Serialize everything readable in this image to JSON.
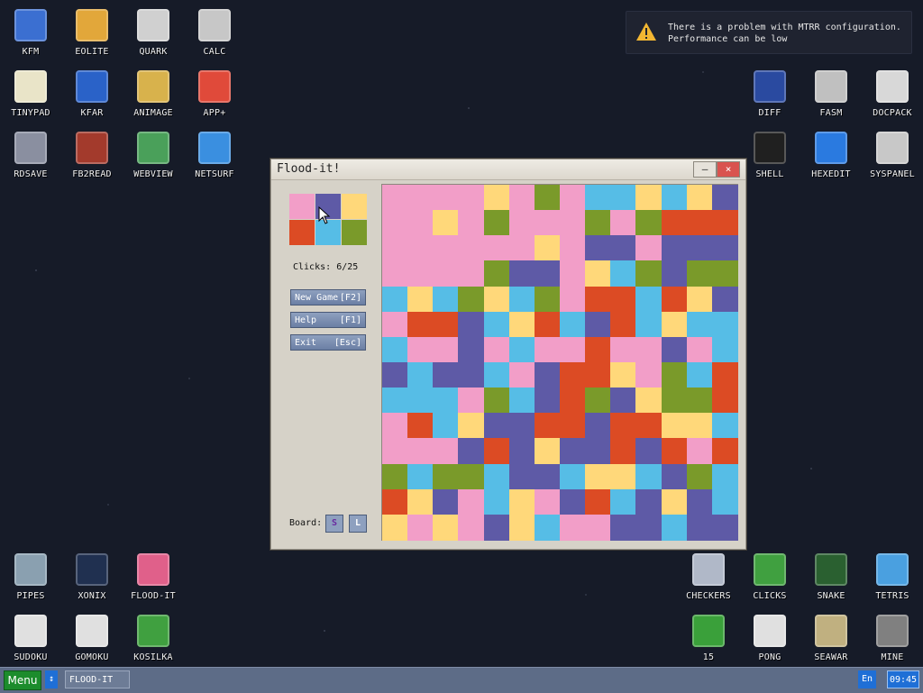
{
  "desktop": {
    "icons": [
      {
        "label": "KFM",
        "icon": "floppy-icon"
      },
      {
        "label": "EOLITE",
        "icon": "folder-icon"
      },
      {
        "label": "QUARK",
        "icon": "notebook-icon"
      },
      {
        "label": "CALC",
        "icon": "calculator-icon"
      },
      {
        "label": "TINYPAD",
        "icon": "notepad-icon"
      },
      {
        "label": "KFAR",
        "icon": "filemanager-icon"
      },
      {
        "label": "ANIMAGE",
        "icon": "paint-tools-icon"
      },
      {
        "label": "APP+",
        "icon": "cube-icon"
      },
      {
        "label": "RDSAVE",
        "icon": "disk-save-icon"
      },
      {
        "label": "FB2READ",
        "icon": "book-icon"
      },
      {
        "label": "WEBVIEW",
        "icon": "web-image-icon"
      },
      {
        "label": "NETSURF",
        "icon": "globe-icon"
      },
      {
        "label": "DIFF",
        "icon": "diff-icon"
      },
      {
        "label": "FASM",
        "icon": "assembler-icon"
      },
      {
        "label": "DOCPACK",
        "icon": "cabinet-icon"
      },
      {
        "label": "SHELL",
        "icon": "terminal-icon"
      },
      {
        "label": "HEXEDIT",
        "icon": "hex-icon"
      },
      {
        "label": "SYSPANEL",
        "icon": "sliders-icon"
      },
      {
        "label": "PIPES",
        "icon": "pipes-icon"
      },
      {
        "label": "XONIX",
        "icon": "xonix-icon"
      },
      {
        "label": "FLOOD-IT",
        "icon": "flood-icon"
      },
      {
        "label": "SUDOKU",
        "icon": "sudoku-icon"
      },
      {
        "label": "GOMOKU",
        "icon": "gomoku-icon"
      },
      {
        "label": "KOSILKA",
        "icon": "lawnmower-icon"
      },
      {
        "label": "CHECKERS",
        "icon": "checkers-icon"
      },
      {
        "label": "CLICKS",
        "icon": "clicks-icon"
      },
      {
        "label": "SNAKE",
        "icon": "snake-icon"
      },
      {
        "label": "TETRIS",
        "icon": "tetris-icon"
      },
      {
        "label": "15",
        "icon": "fifteen-icon"
      },
      {
        "label": "PONG",
        "icon": "pong-icon"
      },
      {
        "label": "SEAWAR",
        "icon": "seawar-icon"
      },
      {
        "label": "MINE",
        "icon": "mine-icon"
      }
    ]
  },
  "notification": {
    "line1": "There is a problem with MTRR configuration.",
    "line2": "Performance can be low"
  },
  "window": {
    "title": "Flood-it!",
    "minimize": "–",
    "close": "×",
    "clicks_label": "Clicks:",
    "clicks_value": "6/25",
    "buttons": [
      {
        "label": "New Game",
        "key": "[F2]"
      },
      {
        "label": "Help",
        "key": "[F1]"
      },
      {
        "label": "Exit",
        "key": "[Esc]"
      }
    ],
    "board_label": "Board:",
    "size_s": "S",
    "size_l": "L"
  },
  "colors": {
    "P": "#f29ec8",
    "V": "#5e5aa6",
    "Y": "#ffd87a",
    "R": "#dc4b24",
    "B": "#56bde6",
    "G": "#7a9a2a"
  },
  "palette": [
    "P",
    "V",
    "Y",
    "R",
    "B",
    "G"
  ],
  "board": [
    "PPPPYPGPBBYBYV",
    "PPYPGPPPGPGRRR",
    "PPPPPPYPVVPVVV",
    "PPPPGVVPYBGVGG",
    "BYBGYBGPRRBRYV",
    "PRRVBYRBVRBYBB",
    "BPPVPBPPRPPVPB",
    "VBVVBPVRRYPGBR",
    "BBBPGBVRGVYGGR",
    "PRBYVVRRVRRYYB",
    "PPPVRVYVVRVRPR",
    "GBGGBVVBYYBVGB",
    "RYVPBYPVRBVYVB",
    "YPYPVYBPPVVBVV"
  ],
  "taskbar": {
    "menu": "Menu",
    "arrows": "↕",
    "task": "FLOOD-IT",
    "lang": "En",
    "clock": "09:45"
  }
}
